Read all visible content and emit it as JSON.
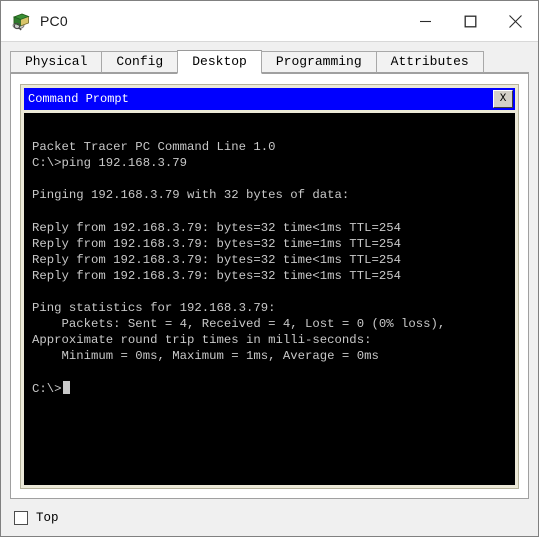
{
  "window": {
    "title": "PC0",
    "icon": "pc-device-icon",
    "controls": {
      "minimize": "minimize-icon",
      "maximize": "maximize-icon",
      "close": "close-icon"
    }
  },
  "tabs": [
    {
      "label": "Physical",
      "active": false
    },
    {
      "label": "Config",
      "active": false
    },
    {
      "label": "Desktop",
      "active": true
    },
    {
      "label": "Programming",
      "active": false
    },
    {
      "label": "Attributes",
      "active": false
    }
  ],
  "command_prompt": {
    "title": "Command Prompt",
    "close_label": "X",
    "titlebar_color": "#0000ff",
    "screen_bg": "#000000",
    "text_color": "#c8c8c8",
    "lines": [
      "",
      "Packet Tracer PC Command Line 1.0",
      "C:\\>ping 192.168.3.79",
      "",
      "Pinging 192.168.3.79 with 32 bytes of data:",
      "",
      "Reply from 192.168.3.79: bytes=32 time<1ms TTL=254",
      "Reply from 192.168.3.79: bytes=32 time=1ms TTL=254",
      "Reply from 192.168.3.79: bytes=32 time<1ms TTL=254",
      "Reply from 192.168.3.79: bytes=32 time<1ms TTL=254",
      "",
      "Ping statistics for 192.168.3.79:",
      "    Packets: Sent = 4, Received = 4, Lost = 0 (0% loss),",
      "Approximate round trip times in milli-seconds:",
      "    Minimum = 0ms, Maximum = 1ms, Average = 0ms",
      "",
      "PROMPT_WITH_CURSOR"
    ],
    "prompt": "C:\\>"
  },
  "footer": {
    "top_checkbox_label": "Top",
    "top_checkbox_checked": false
  }
}
